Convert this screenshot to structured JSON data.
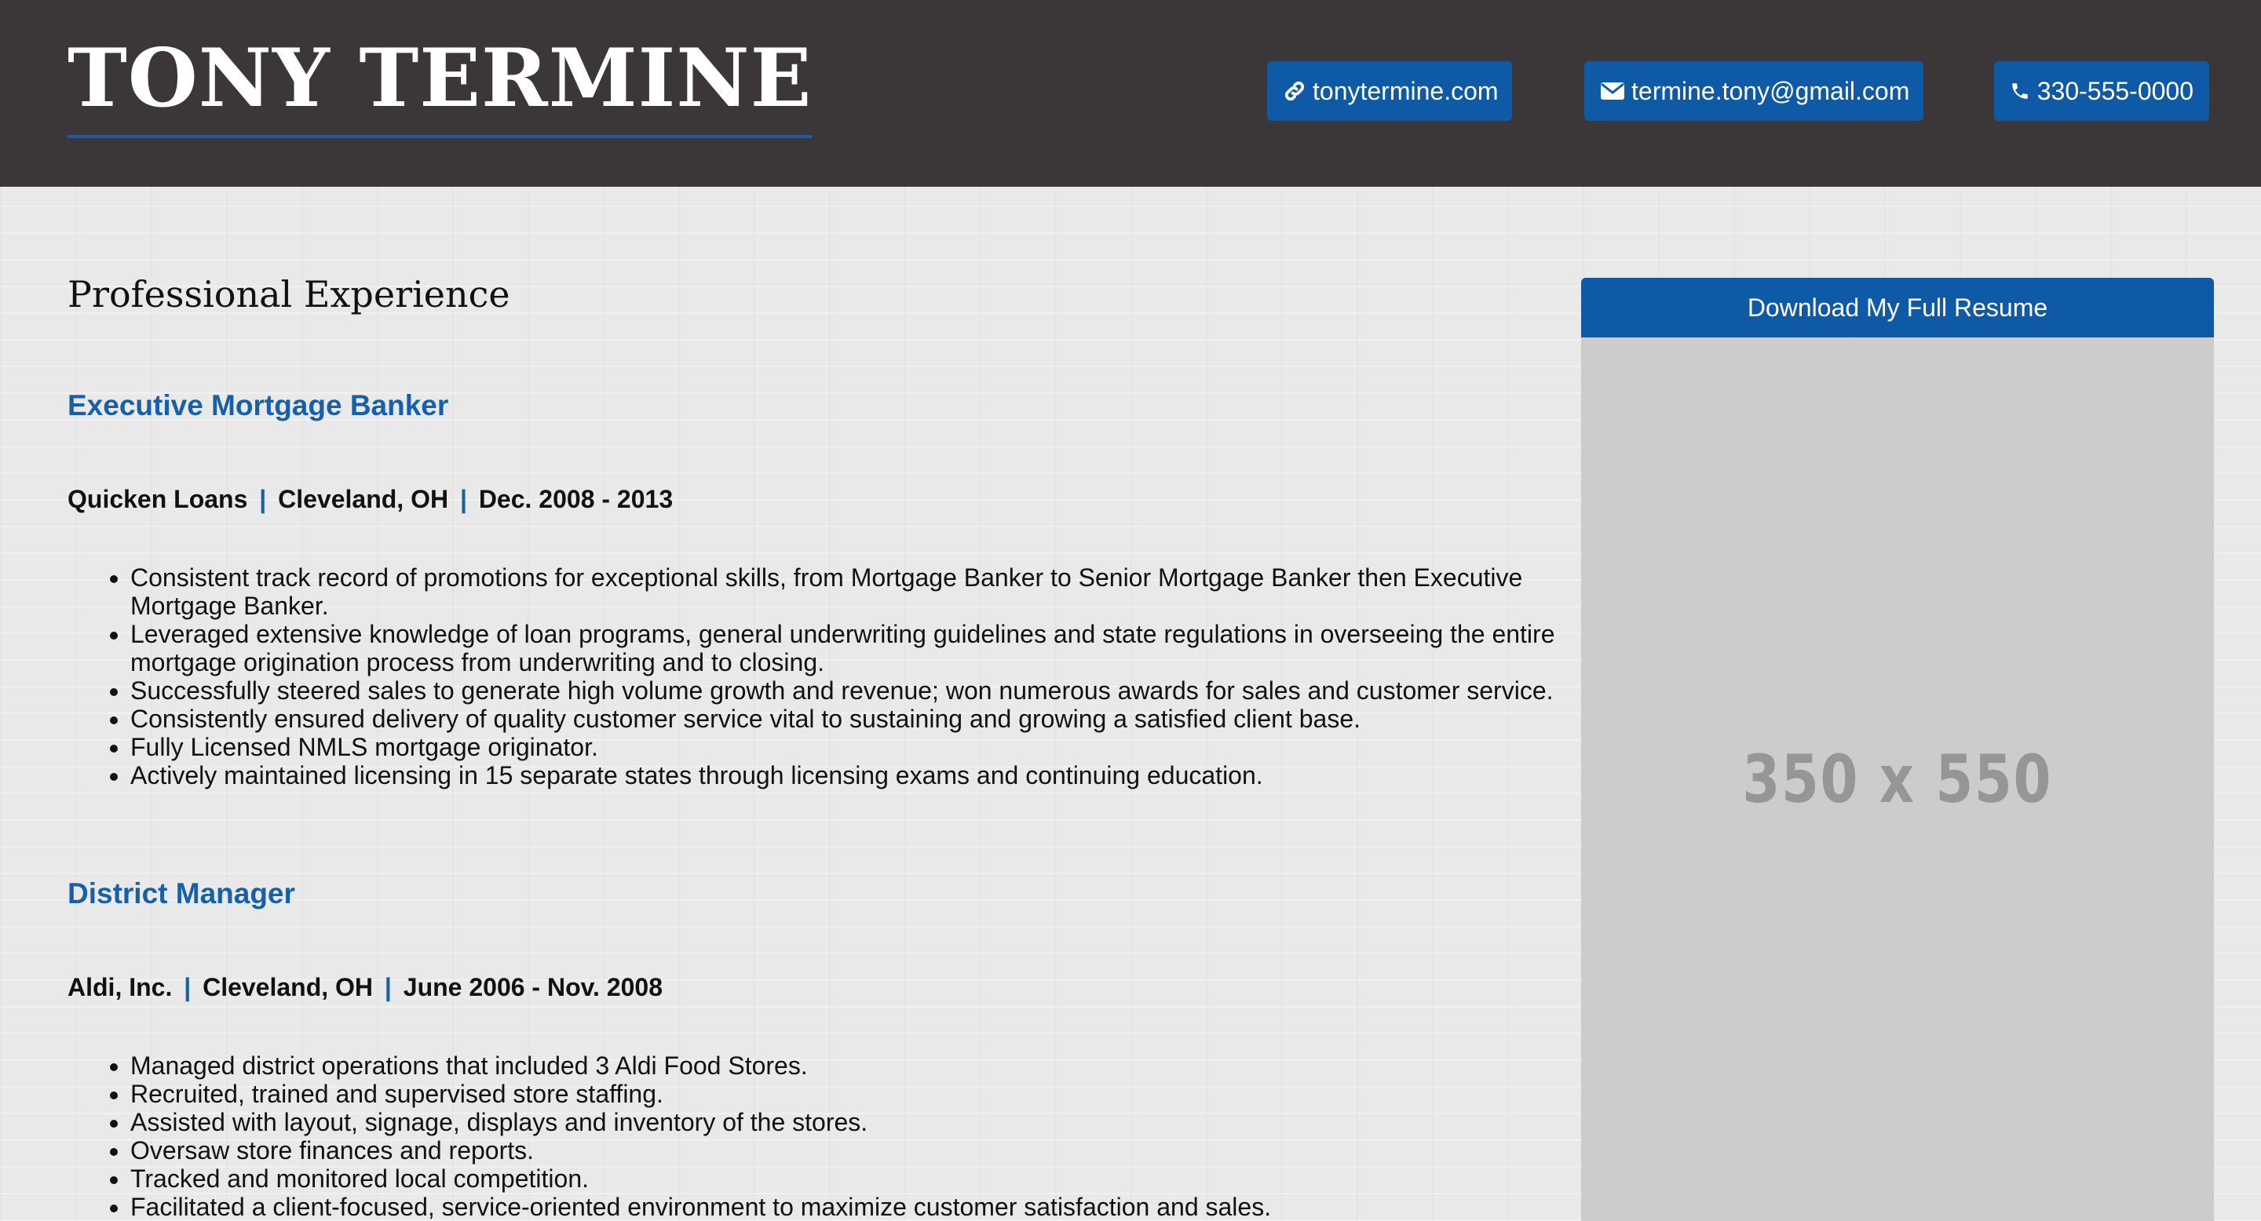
{
  "header": {
    "name": "TONY TERMINE",
    "contacts": {
      "website": {
        "label": "tonytermine.com",
        "icon": "link-icon"
      },
      "email": {
        "label": "termine.tony@gmail.com",
        "icon": "envelope-icon"
      },
      "phone": {
        "label": "330-555-0000",
        "icon": "phone-icon"
      }
    }
  },
  "main": {
    "section_title": "Professional Experience",
    "jobs": [
      {
        "title": "Executive Mortgage Banker",
        "company": "Quicken Loans",
        "location": "Cleveland, OH",
        "dates": "Dec. 2008 - 2013",
        "separator": "|",
        "bullets": [
          "Consistent track record of promotions for exceptional skills, from Mortgage Banker to Senior Mortgage Banker then Executive Mortgage Banker.",
          "Leveraged extensive knowledge of loan programs, general underwriting guidelines and state regulations in overseeing the entire mortgage origination process from underwriting and to closing.",
          "Successfully steered sales to generate high volume growth and revenue; won numerous awards for sales and customer service.",
          "Consistently ensured delivery of quality customer service vital to sustaining and growing a satisfied client base.",
          "Fully Licensed NMLS mortgage originator.",
          "Actively maintained licensing in 15 separate states through licensing exams and continuing education."
        ]
      },
      {
        "title": "District Manager",
        "company": "Aldi, Inc.",
        "location": "Cleveland, OH",
        "dates": "June 2006 - Nov. 2008",
        "separator": "|",
        "bullets": [
          "Managed district operations that included 3 Aldi Food Stores.",
          "Recruited, trained and supervised store staffing.",
          "Assisted with layout, signage, displays and inventory of the stores.",
          "Oversaw store finances and reports.",
          "Tracked and monitored local competition.",
          "Facilitated a client-focused, service-oriented environment to maximize customer satisfaction and sales."
        ]
      }
    ]
  },
  "sidebar": {
    "download_label": "Download My Full Resume",
    "placeholder_text": "350 x 550"
  },
  "colors": {
    "header_bg": "#3b3738",
    "accent_blue": "#0e5aa7",
    "job_title_blue": "#1560a8",
    "placeholder_bg": "#cccccc"
  }
}
